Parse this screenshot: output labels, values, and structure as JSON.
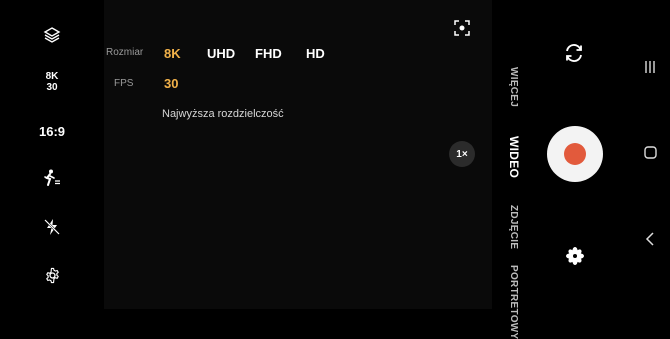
{
  "left_toolbar": {
    "layers_icon": "layers-icon",
    "resolution_badge": {
      "line1": "8K",
      "line2": "30"
    },
    "aspect_ratio": "16:9",
    "motion_icon": "motion-photo-icon",
    "flash_icon": "flash-off-icon",
    "settings_icon": "gear-icon"
  },
  "options_panel": {
    "size_label": "Rozmiar",
    "size_options": [
      "8K",
      "UHD",
      "FHD",
      "HD"
    ],
    "size_selected": "8K",
    "fps_label": "FPS",
    "fps_options": [
      "30"
    ],
    "fps_selected": "30",
    "hint": "Najwyższa rozdzielczość"
  },
  "zoom": {
    "label": "1×"
  },
  "modes": {
    "more": "WIĘCEJ",
    "video": "WIDEO",
    "photo": "ZDJĘCIE",
    "portrait": "PORTRETOWY",
    "active": "WIDEO"
  },
  "top_right_icons": {
    "focus": "focus-frame-icon",
    "switch_camera": "switch-camera-icon"
  },
  "bottom_icons": {
    "effects": "flower-filter-icon"
  },
  "navbar": {
    "recents": "recents-icon",
    "home": "home-icon",
    "back": "back-icon"
  },
  "colors": {
    "accent": "#f2b24a",
    "record": "#e25a3c",
    "background": "#000000"
  }
}
